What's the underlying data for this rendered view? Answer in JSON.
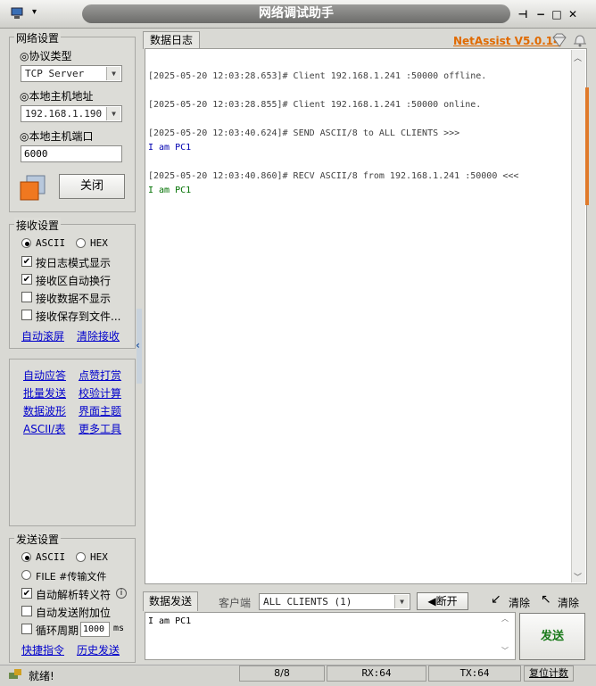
{
  "window": {
    "title": "网络调试助手",
    "sys_menu_glyph": "▾",
    "pin_glyph": "⊣",
    "min_glyph": "−",
    "max_glyph": "□",
    "close_glyph": "✕"
  },
  "network": {
    "legend": "网络设置",
    "protocol_label": "◎协议类型",
    "protocol_value": "TCP Server",
    "host_label": "◎本地主机地址",
    "host_value": "192.168.1.190",
    "port_label": "◎本地主机端口",
    "port_value": "6000",
    "close_button": "关闭"
  },
  "receive": {
    "legend": "接收设置",
    "ascii": "ASCII",
    "hex": "HEX",
    "opt_log_mode": "按日志模式显示",
    "opt_auto_wrap": "接收区自动换行",
    "opt_hide_data": "接收数据不显示",
    "opt_save_file": "接收保存到文件...",
    "link_auto_scroll": "自动滚屏",
    "link_clear": "清除接收"
  },
  "tools": {
    "auto_reply": "自动应答",
    "tip": "点赞打赏",
    "batch_send": "批量发送",
    "checksum": "校验计算",
    "waveform": "数据波形",
    "theme": "界面主题",
    "ascii_table": "ASCII/表",
    "more_tools": "更多工具"
  },
  "send": {
    "legend": "发送设置",
    "ascii": "ASCII",
    "hex": "HEX",
    "file": "FILE #传输文件",
    "opt_escape": "自动解析转义符",
    "opt_append": "自动发送附加位",
    "opt_cycle": "循环周期",
    "cycle_value": "1000",
    "cycle_unit": "ms",
    "link_shortcuts": "快捷指令",
    "link_history": "历史发送"
  },
  "log": {
    "tab": "数据日志",
    "brand": "NetAssist V5.0.14",
    "lines": [
      {
        "text": "[2025-05-20 12:03:28.653]# Client 192.168.1.241 :50000 offline.",
        "color": "#404040"
      },
      {
        "text": "[2025-05-20 12:03:28.855]# Client 192.168.1.241 :50000 online.",
        "color": "#404040"
      },
      {
        "text": "[2025-05-20 12:03:40.624]# SEND ASCII/8 to ALL CLIENTS >>>",
        "color": "#404040"
      },
      {
        "text": "I am PC1",
        "color": "#0000b0"
      },
      {
        "text": "[2025-05-20 12:03:40.860]# RECV ASCII/8 from 192.168.1.241 :50000 <<<",
        "color": "#404040"
      },
      {
        "text": "I am PC1",
        "color": "#007000"
      }
    ]
  },
  "sendbar": {
    "tab": "数据发送",
    "client_label": "客户端",
    "client_value": "ALL CLIENTS (1)",
    "disconnect": "断开",
    "clear1": "清除",
    "clear2": "清除",
    "input_value": "I am PC1",
    "send_button": "发送"
  },
  "status": {
    "ready": "就绪!",
    "count": "8/8",
    "rx": "RX:64",
    "tx": "TX:64",
    "reset": "复位计数"
  },
  "colors": {
    "brand": "#e06a00",
    "send_green": "#1a7a1a",
    "link": "#0000cc"
  }
}
